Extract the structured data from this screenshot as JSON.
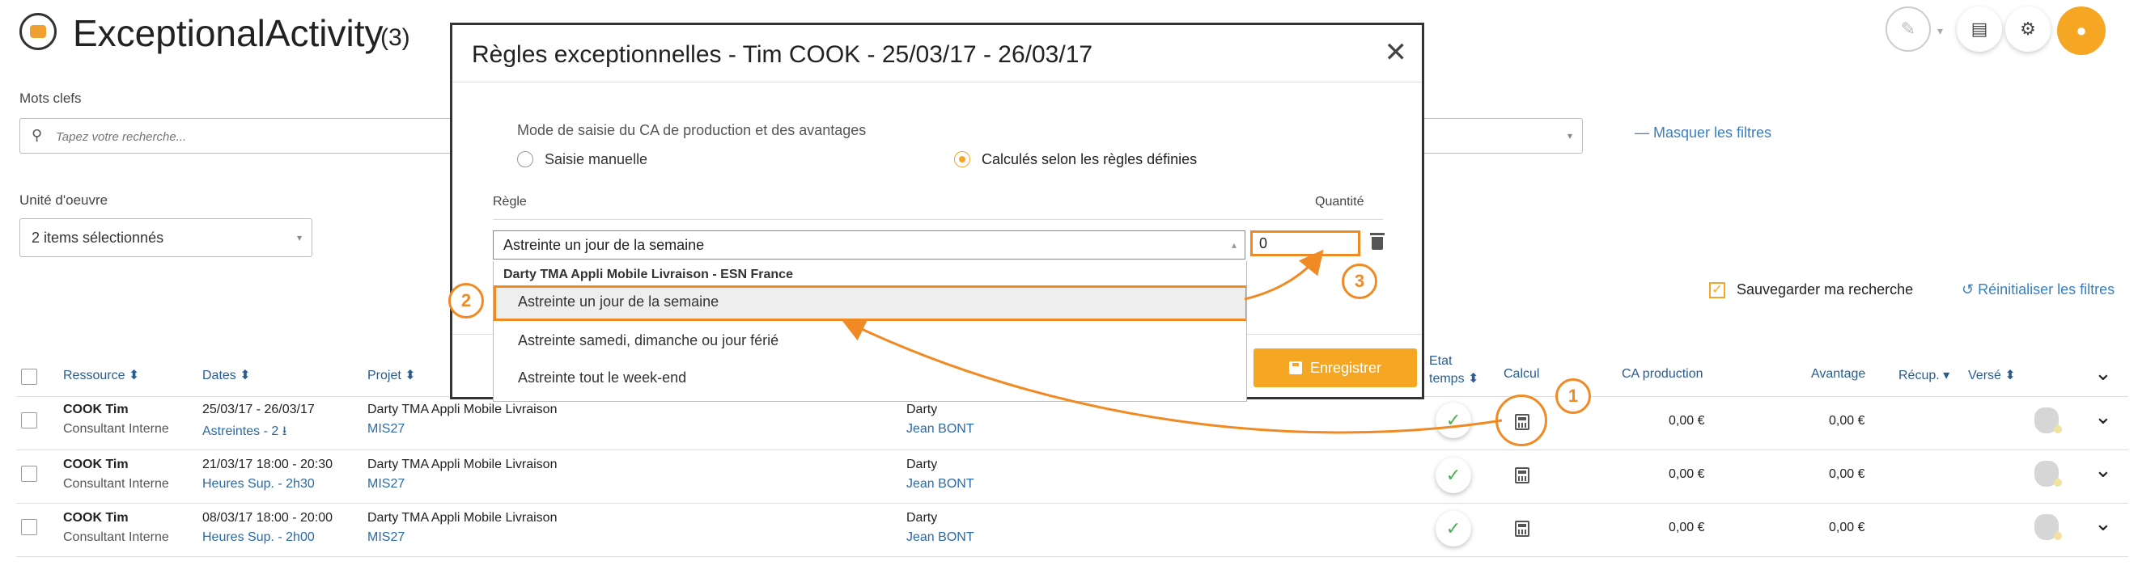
{
  "header": {
    "title": "ExceptionalActivity",
    "count": "(3)"
  },
  "filters": {
    "keywords_label": "Mots clefs",
    "search_placeholder": "Tapez votre recherche...",
    "hide_filters": "— Masquer les filtres",
    "unit_label": "Unité d'oeuvre",
    "unit_value": "2 items sélectionnés",
    "save_search": "Sauvegarder ma recherche",
    "reset_filters": "Réinitialiser les filtres"
  },
  "table": {
    "headers": {
      "resource": "Ressource ⬍",
      "dates": "Dates ⬍",
      "project": "Projet ⬍",
      "etat_line1": "Etat",
      "etat_line2": "temps ⬍",
      "calcul": "Calcul",
      "ca": "CA production",
      "avantage": "Avantage",
      "recup": "Récup. ▾",
      "verse": "Versé ⬍"
    },
    "rows": [
      {
        "name": "COOK Tim",
        "role": "Consultant Interne",
        "dates": "25/03/17 - 26/03/17",
        "detail": "Astreintes - 2 ⭳",
        "project": "Darty TMA Appli Mobile Livraison",
        "project_code": "MIS27",
        "client": "Darty",
        "contact": "Jean BONT",
        "ca": "0,00 €",
        "avantage": "0,00 €"
      },
      {
        "name": "COOK Tim",
        "role": "Consultant Interne",
        "dates": "21/03/17 18:00 - 20:30",
        "detail": "Heures Sup. - 2h30",
        "project": "Darty TMA Appli Mobile Livraison",
        "project_code": "MIS27",
        "client": "Darty",
        "contact": "Jean BONT",
        "ca": "0,00 €",
        "avantage": "0,00 €"
      },
      {
        "name": "COOK Tim",
        "role": "Consultant Interne",
        "dates": "08/03/17 18:00 - 20:00",
        "detail": "Heures Sup. - 2h00",
        "project": "Darty TMA Appli Mobile Livraison",
        "project_code": "MIS27",
        "client": "Darty",
        "contact": "Jean BONT",
        "ca": "0,00 €",
        "avantage": "0,00 €"
      }
    ]
  },
  "modal": {
    "title": "Règles exceptionnelles - Tim COOK - 25/03/17 - 26/03/17",
    "mode_label": "Mode de saisie du CA de production et des avantages",
    "option_manual": "Saisie manuelle",
    "option_rules": "Calculés selon les règles définies",
    "col_rule": "Règle",
    "col_qty": "Quantité",
    "rule_value": "Astreinte un jour de la semaine",
    "qty_value": "0",
    "save_button": "Enregistrer",
    "dropdown": {
      "group": "Darty TMA Appli Mobile Livraison - ESN France",
      "items": [
        "Astreinte un jour de la semaine",
        "Astreinte samedi, dimanche ou jour férié",
        "Astreinte tout le week-end"
      ]
    }
  },
  "annotations": {
    "step1": "1",
    "step2": "2",
    "step3": "3"
  },
  "colors": {
    "accent": "#f5a623",
    "annotation": "#f08a24",
    "link": "#3a7fbf"
  }
}
